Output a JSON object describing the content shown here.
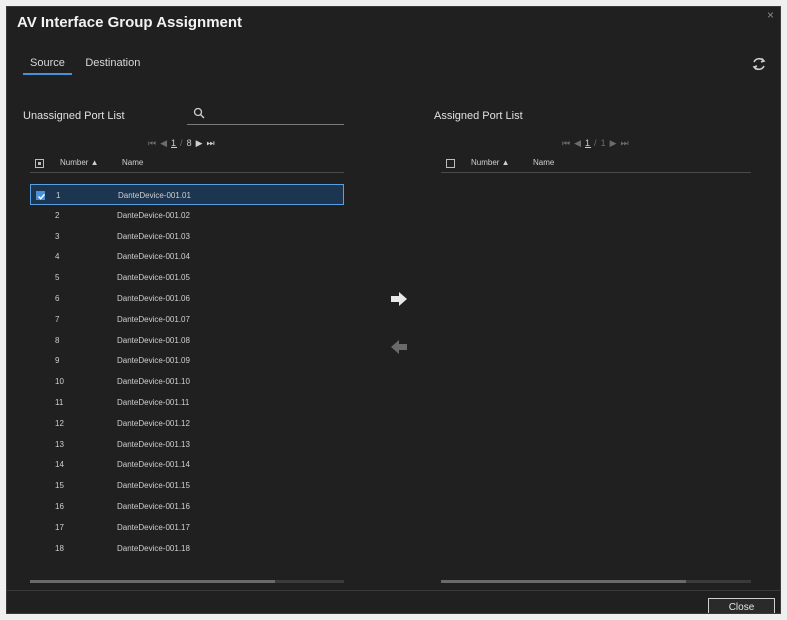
{
  "window": {
    "title": "AV Interface Group Assignment",
    "close_glyph": "×"
  },
  "tabs": [
    {
      "label": "Source",
      "active": true
    },
    {
      "label": "Destination",
      "active": false
    }
  ],
  "unassigned": {
    "label": "Unassigned Port List",
    "search": {
      "value": "",
      "placeholder": ""
    },
    "pager": {
      "first": "⏮",
      "prev": "◀",
      "page": "1",
      "sep": "/",
      "total": "8",
      "next": "▶",
      "last": "⏭"
    },
    "headers": {
      "number": "Number ▲",
      "name": "Name"
    },
    "rows": [
      {
        "number": "1",
        "name": "DanteDevice-001.01",
        "selected": true
      },
      {
        "number": "2",
        "name": "DanteDevice-001.02"
      },
      {
        "number": "3",
        "name": "DanteDevice-001.03"
      },
      {
        "number": "4",
        "name": "DanteDevice-001.04"
      },
      {
        "number": "5",
        "name": "DanteDevice-001.05"
      },
      {
        "number": "6",
        "name": "DanteDevice-001.06"
      },
      {
        "number": "7",
        "name": "DanteDevice-001.07"
      },
      {
        "number": "8",
        "name": "DanteDevice-001.08"
      },
      {
        "number": "9",
        "name": "DanteDevice-001.09"
      },
      {
        "number": "10",
        "name": "DanteDevice-001.10"
      },
      {
        "number": "11",
        "name": "DanteDevice-001.11"
      },
      {
        "number": "12",
        "name": "DanteDevice-001.12"
      },
      {
        "number": "13",
        "name": "DanteDevice-001.13"
      },
      {
        "number": "14",
        "name": "DanteDevice-001.14"
      },
      {
        "number": "15",
        "name": "DanteDevice-001.15"
      },
      {
        "number": "16",
        "name": "DanteDevice-001.16"
      },
      {
        "number": "17",
        "name": "DanteDevice-001.17"
      },
      {
        "number": "18",
        "name": "DanteDevice-001.18"
      }
    ]
  },
  "assigned": {
    "label": "Assigned Port List",
    "pager": {
      "first": "⏮",
      "prev": "◀",
      "page": "1",
      "sep": "/",
      "total": "1",
      "next": "▶",
      "last": "⏭"
    },
    "headers": {
      "number": "Number ▲",
      "name": "Name"
    },
    "rows": []
  },
  "icons": {
    "search": "search-icon",
    "refresh": "refresh-icon",
    "assign": "arrow-right-icon",
    "unassign": "arrow-left-icon"
  },
  "colors": {
    "accent": "#4a90d6",
    "background": "#202020",
    "text": "#d8d8d8"
  },
  "footer": {
    "close_label": "Close"
  }
}
